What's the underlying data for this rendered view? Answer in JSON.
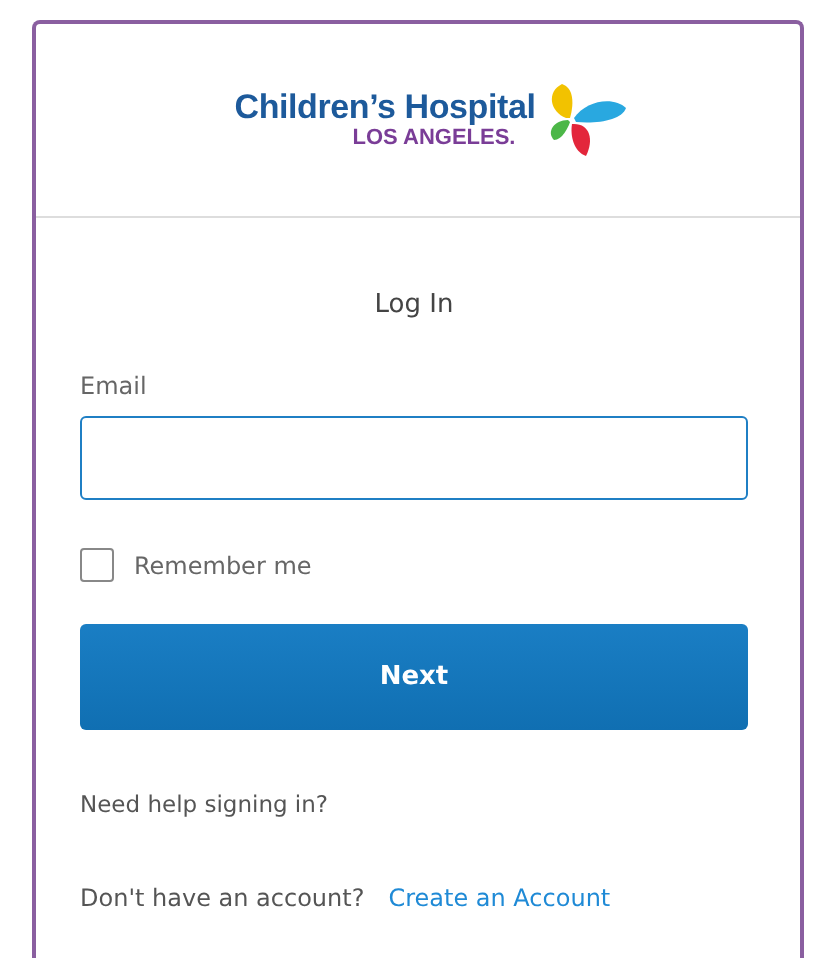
{
  "logo": {
    "name": "Children’s Hospital",
    "subtitle": "LOS ANGELES."
  },
  "title": "Log In",
  "email": {
    "label": "Email",
    "focused": true
  },
  "remember": {
    "label": "Remember me",
    "checked": false
  },
  "next_button": "Next",
  "help_link": "Need help signing in?",
  "signup": {
    "prompt": "Don't have an account?",
    "link": "Create an Account"
  }
}
